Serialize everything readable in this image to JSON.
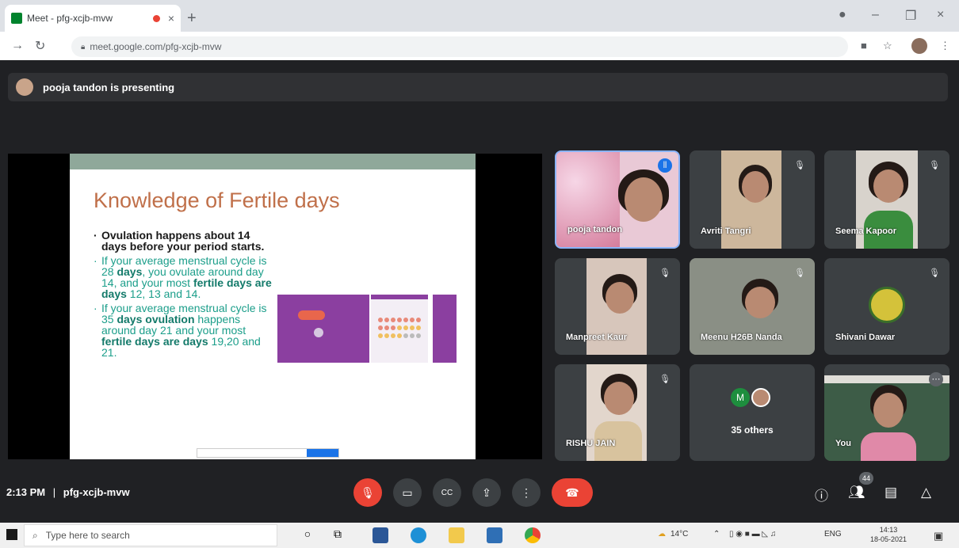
{
  "browser": {
    "tab_title": "Meet - pfg-xcjb-mvw",
    "url": "meet.google.com/pfg-xcjb-mvw",
    "new_tab": "+",
    "close_tab": "×"
  },
  "presenting": {
    "text": "pooja tandon is presenting"
  },
  "slide": {
    "title": "Knowledge of Fertile days",
    "bullet1": "Ovulation happens about 14 days before your period starts.",
    "bullet2_pre": "If your average menstrual cycle is 28 ",
    "bullet2_b1": "days",
    "bullet2_mid": ", you ovulate around day 14, and your most ",
    "bullet2_b2": "fertile days are days",
    "bullet2_post": " 12, 13 and 14.",
    "bullet3_pre": "If your average menstrual cycle is 35 ",
    "bullet3_b1": "days ovulation",
    "bullet3_mid": " happens around day 21 and your most ",
    "bullet3_b2": "fertile days are days",
    "bullet3_post": " 19,20 and 21."
  },
  "participants": [
    {
      "name": "pooja tandon",
      "speaking": true
    },
    {
      "name": "Avriti Tangri"
    },
    {
      "name": "Seema Kapoor"
    },
    {
      "name": "Manpreet Kaur"
    },
    {
      "name": "Meenu H26B Nanda"
    },
    {
      "name": "Shivani Dawar"
    },
    {
      "name": "RISHU JAIN"
    },
    {
      "name": "35 others",
      "initial": "M"
    },
    {
      "name": "You"
    }
  ],
  "controls": {
    "time": "2:13 PM",
    "separator": "|",
    "meeting_code": "pfg-xcjb-mvw",
    "participant_count": "44"
  },
  "taskbar": {
    "search_placeholder": "Type here to search",
    "weather": "14°C",
    "lang": "ENG",
    "time": "14:13",
    "date": "18-05-2021"
  },
  "colors": {
    "mic_off": "#ea4335",
    "speaking_border": "#8ab4f8",
    "slide_title": "#c0704a",
    "slide_teal": "#1b9e8a"
  }
}
